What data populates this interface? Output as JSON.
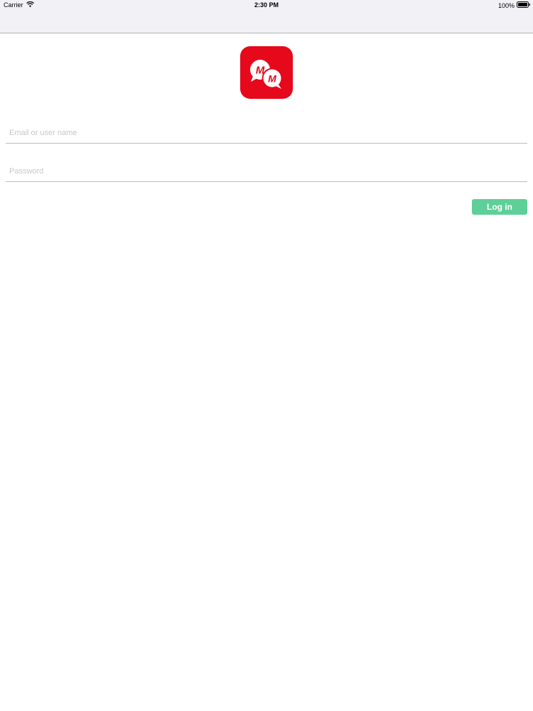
{
  "status_bar": {
    "carrier": "Carrier",
    "time": "2:30 PM",
    "battery": "100%",
    "wifi_icon": "wifi-icon",
    "battery_icon": "battery-icon"
  },
  "logo": {
    "icon": "chat-bubbles-logo-icon",
    "text": "MM",
    "bg_color": "#e6081b"
  },
  "login_form": {
    "username_placeholder": "Email or user name",
    "username_value": "",
    "password_placeholder": "Password",
    "password_value": "",
    "login_label": "Log in",
    "button_color": "#5fcf98"
  }
}
